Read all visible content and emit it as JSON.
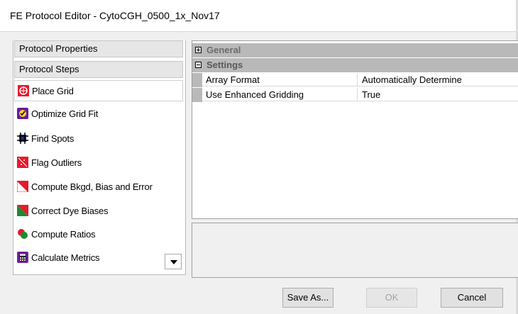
{
  "window": {
    "title": "FE Protocol Editor - CytoCGH_0500_1x_Nov17"
  },
  "left": {
    "properties_label": "Protocol Properties",
    "steps_label": "Protocol Steps",
    "steps": [
      {
        "label": "Place Grid",
        "icon": "place-grid-icon",
        "selected": true
      },
      {
        "label": "Optimize Grid Fit",
        "icon": "optimize-grid-fit-icon"
      },
      {
        "label": "Find Spots",
        "icon": "find-spots-icon"
      },
      {
        "label": "Flag Outliers",
        "icon": "flag-outliers-icon"
      },
      {
        "label": "Compute Bkgd, Bias and Error",
        "icon": "compute-bkgd-icon"
      },
      {
        "label": "Correct Dye Biases",
        "icon": "correct-dye-biases-icon"
      },
      {
        "label": "Compute Ratios",
        "icon": "compute-ratios-icon"
      },
      {
        "label": "Calculate Metrics",
        "icon": "calculate-metrics-icon"
      }
    ]
  },
  "grid": {
    "categories": [
      {
        "label": "General",
        "expanded": false
      },
      {
        "label": "Settings",
        "expanded": true
      }
    ],
    "properties": [
      {
        "name": "Array Format",
        "value": "Automatically Determine"
      },
      {
        "name": "Use Enhanced Gridding",
        "value": "True"
      }
    ]
  },
  "buttons": {
    "save_as": "Save As...",
    "ok": "OK",
    "cancel": "Cancel"
  },
  "colors": {
    "category_bg": "#b9b9b9",
    "window_bg": "#f0f0f0"
  }
}
